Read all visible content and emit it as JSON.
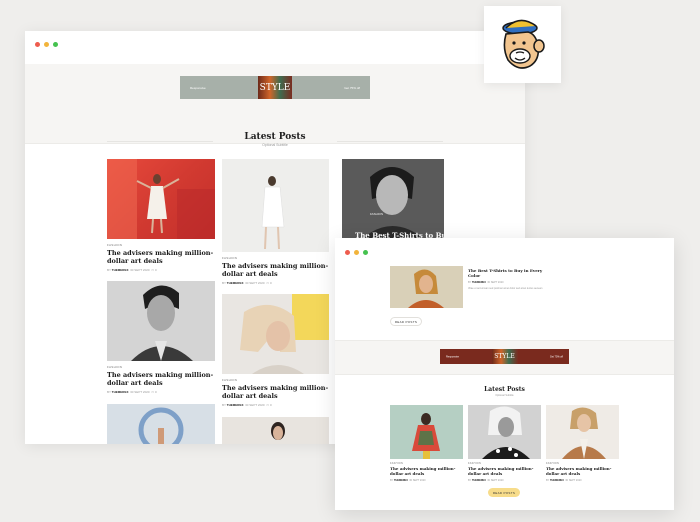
{
  "window_main": {
    "dots": [
      "#ee5c4e",
      "#f2b43b",
      "#45c24f"
    ],
    "banner": {
      "left_text": "Responsive",
      "center_text": "STYLE",
      "right_text": "Get 75% off"
    },
    "section": {
      "title": "Latest Posts",
      "subtitle": "Optional Subtitle"
    },
    "posts": [
      {
        "category": "FASHION",
        "title": "The advisers making million-dollar art deals",
        "author": "THEMEREX",
        "date": "30 SEPT 2020",
        "comments": "0"
      },
      {
        "category": "FASHION",
        "title": "The advisers making million-dollar art deals",
        "author": "THEMEREX",
        "date": "30 SEPT 2020",
        "comments": "0"
      },
      {
        "category": "FASHION",
        "title": "The Best T-Shirts to Buy in"
      },
      {
        "category": "FASHION",
        "title": "The advisers making million-dollar art deals",
        "author": "THEMEREX",
        "date": "30 SEPT 2020",
        "comments": "0"
      },
      {
        "category": "FASHION",
        "title": "The advisers making million-dollar art deals",
        "author": "THEMEREX",
        "date": "30 SEPT 2020",
        "comments": "0"
      }
    ],
    "by_label": "BY"
  },
  "window_secondary": {
    "dots": [
      "#ee5c4e",
      "#f2b43b",
      "#45c24f"
    ],
    "featured": {
      "title": "The Best T-Shirts to Buy in Every Color",
      "author": "THEMEREX",
      "date": "30 SEPT 2020",
      "excerpt": "Vitae et accumsan sed pulvinar amet dolor sed amet lectus aenean",
      "button": "READ POSTS"
    },
    "banner": {
      "left_text": "Responsive",
      "center_text": "STYLE",
      "right_text": "Get 75% off"
    },
    "section": {
      "title": "Latest Posts",
      "subtitle": "Optional Subtitle"
    },
    "posts": [
      {
        "category": "FASHION",
        "title": "The advisers making million-dollar art deals",
        "author": "THEMEREX",
        "date": "30 SEPT 2020"
      },
      {
        "category": "FASHION",
        "title": "The advisers making million-dollar art deals",
        "author": "THEMEREX",
        "date": "30 SEPT 2020"
      },
      {
        "category": "FASHION",
        "title": "The advisers making million-dollar art deals",
        "author": "THEMEREX",
        "date": "30 SEPT 2020"
      }
    ],
    "button": "READ POSTS",
    "by_label": "BY"
  },
  "colors": {
    "accent_button": "#f7dc8a",
    "page_bg": "#efeeec"
  },
  "logo": {
    "name": "mailchimp-freddie-icon"
  }
}
